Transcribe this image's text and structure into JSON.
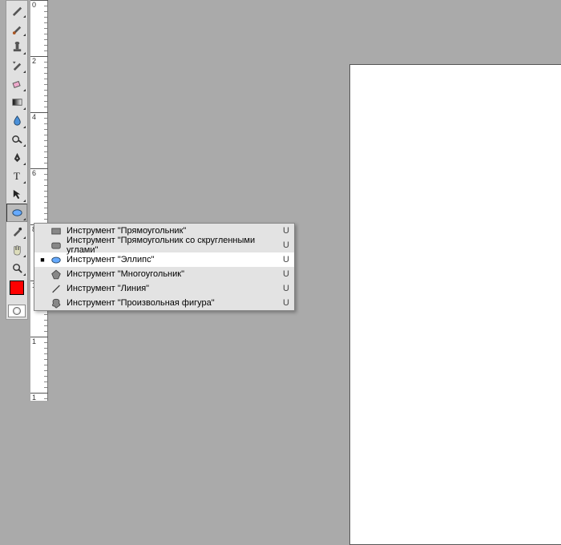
{
  "ruler": {
    "ticks": [
      0,
      2,
      4,
      6,
      8,
      1,
      1,
      1
    ]
  },
  "toolbox": {
    "tools": [
      {
        "n": "pen",
        "i": "pen"
      },
      {
        "n": "brush",
        "i": "brush"
      },
      {
        "n": "clone",
        "i": "stamp"
      },
      {
        "n": "history-brush",
        "i": "hist"
      },
      {
        "n": "eraser",
        "i": "eraser"
      },
      {
        "n": "gradient",
        "i": "grad"
      },
      {
        "n": "blur",
        "i": "drop"
      },
      {
        "n": "dodge",
        "i": "dodge"
      },
      {
        "n": "pen-path",
        "i": "nib"
      },
      {
        "n": "type",
        "i": "T"
      },
      {
        "n": "path-select",
        "i": "arrow"
      },
      {
        "n": "shape",
        "i": "ellipse",
        "active": true
      },
      {
        "n": "eyedropper",
        "i": "eyed"
      },
      {
        "n": "hand",
        "i": "hand"
      },
      {
        "n": "zoom",
        "i": "zoom"
      }
    ]
  },
  "flyout": {
    "items": [
      {
        "icon": "rect",
        "label": "Инструмент \"Прямоугольник\"",
        "key": "U",
        "sel": false
      },
      {
        "icon": "rrect",
        "label": "Инструмент \"Прямоугольник со скругленными углами\"",
        "key": "U",
        "sel": false
      },
      {
        "icon": "ellipse",
        "label": "Инструмент \"Эллипс\"",
        "key": "U",
        "sel": true
      },
      {
        "icon": "poly",
        "label": "Инструмент \"Многоугольник\"",
        "key": "U",
        "sel": false
      },
      {
        "icon": "line",
        "label": "Инструмент \"Линия\"",
        "key": "U",
        "sel": false
      },
      {
        "icon": "custom",
        "label": "Инструмент \"Произвольная фигура\"",
        "key": "U",
        "sel": false
      }
    ]
  },
  "colors": {
    "foreground": "#ff0000"
  }
}
